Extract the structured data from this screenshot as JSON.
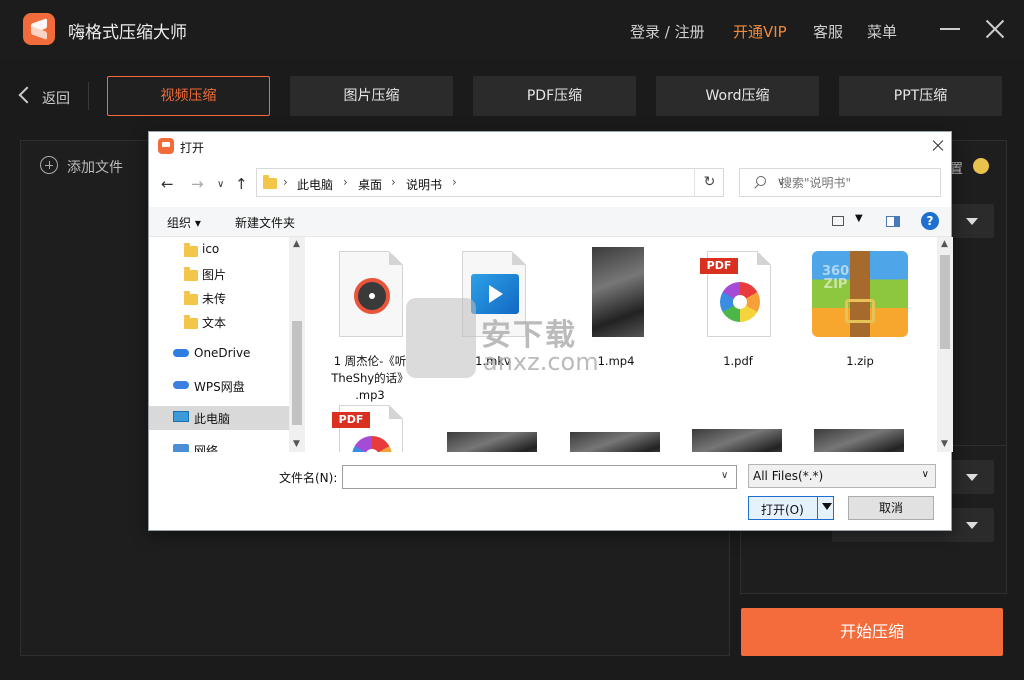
{
  "app": {
    "title": "嗨格式压缩大师",
    "login_label": "登录 / 注册",
    "vip_label": "开通VIP",
    "service_label": "客服",
    "menu_label": "菜单"
  },
  "nav": {
    "back_label": "返回",
    "tabs": [
      {
        "label": "视频压缩",
        "active": true
      },
      {
        "label": "图片压缩"
      },
      {
        "label": "PDF压缩"
      },
      {
        "label": "Word压缩"
      },
      {
        "label": "PPT压缩"
      }
    ]
  },
  "main": {
    "add_file_label": "添加文件",
    "settings_label": "置",
    "start_button_label": "开始压缩"
  },
  "dialog": {
    "title": "打开",
    "breadcrumb": [
      "此电脑",
      "桌面",
      "说明书"
    ],
    "search_placeholder": "搜索\"说明书\"",
    "organize_label": "组织 ▾",
    "new_folder_label": "新建文件夹",
    "nav_items": [
      {
        "label": "ico",
        "icon": "folder-icon"
      },
      {
        "label": "图片",
        "icon": "folder-icon"
      },
      {
        "label": "未传",
        "icon": "folder-icon"
      },
      {
        "label": "文本",
        "icon": "folder-icon"
      },
      {
        "label": "OneDrive",
        "icon": "onedrive-icon"
      },
      {
        "label": "WPS网盘",
        "icon": "wps-cloud-icon"
      },
      {
        "label": "此电脑",
        "icon": "computer-icon",
        "selected": true
      },
      {
        "label": "网络",
        "icon": "network-icon"
      }
    ],
    "files": [
      {
        "name": "1 周杰伦-《听\nTheShy的话》\n.mp3",
        "icon": "music-file-icon"
      },
      {
        "name": "1.mkv",
        "icon": "video-file-icon"
      },
      {
        "name": "1.mp4",
        "icon": "video-thumbnail"
      },
      {
        "name": "1.pdf",
        "icon": "pdf-file-icon"
      },
      {
        "name": "1.zip",
        "icon": "zip-archive-icon"
      }
    ],
    "pdf_badge": "PDF",
    "zip_badge": "360\nZIP",
    "filename_label": "文件名(N):",
    "filename_value": "",
    "filetype_value": "All Files(*.*)",
    "open_button_label": "打开(O)",
    "cancel_button_label": "取消",
    "help_label": "?"
  },
  "watermark": {
    "text": "安下载",
    "sub": "anxz.com"
  },
  "colors": {
    "accent": "#f46c3c",
    "vip": "#f08a3c",
    "background": "#1b1b1b"
  }
}
